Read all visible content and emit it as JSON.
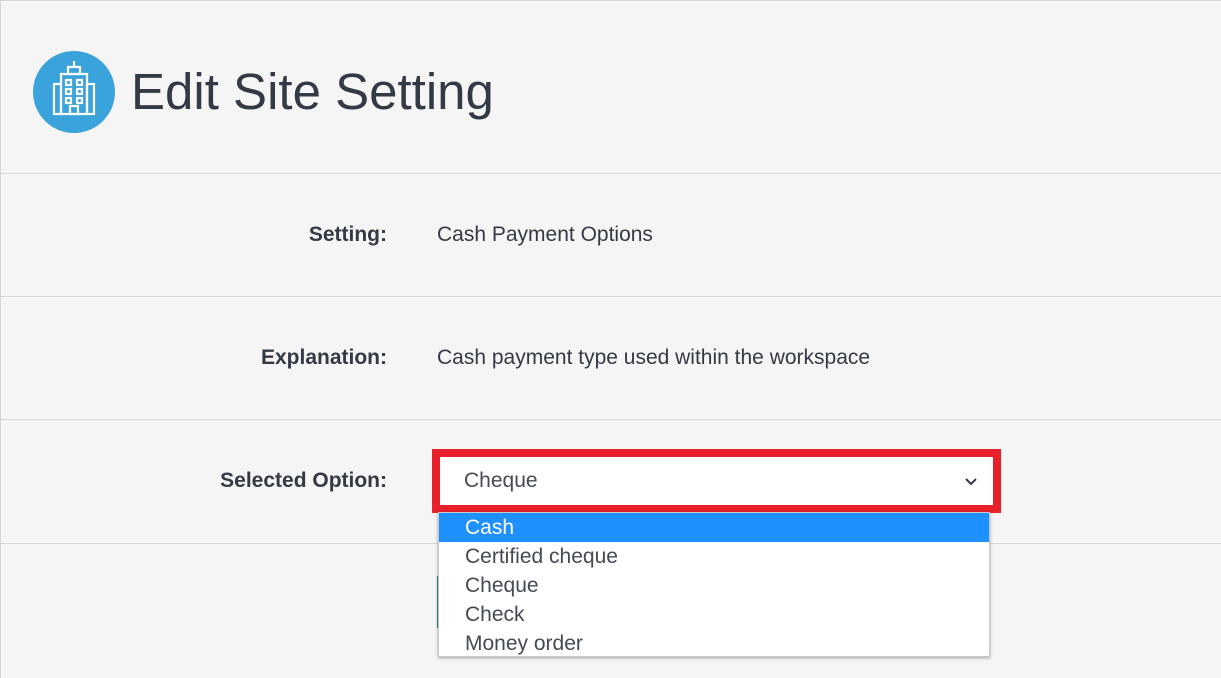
{
  "header": {
    "title": "Edit Site Setting",
    "icon": "building-icon",
    "icon_color": "#3aa3db"
  },
  "rows": {
    "setting": {
      "label": "Setting:",
      "value": "Cash Payment Options"
    },
    "explanation": {
      "label": "Explanation:",
      "value": "Cash payment type used within the workspace"
    },
    "selected_option": {
      "label": "Selected Option:",
      "value": "Cheque"
    }
  },
  "dropdown": {
    "highlight_color": "#1e90ff",
    "options": [
      {
        "label": "Cash",
        "highlighted": true
      },
      {
        "label": "Certified cheque",
        "highlighted": false
      },
      {
        "label": "Cheque",
        "highlighted": false
      },
      {
        "label": "Check",
        "highlighted": false
      },
      {
        "label": "Money order",
        "highlighted": false
      }
    ]
  },
  "annotation": {
    "box_color": "#e8202a"
  }
}
